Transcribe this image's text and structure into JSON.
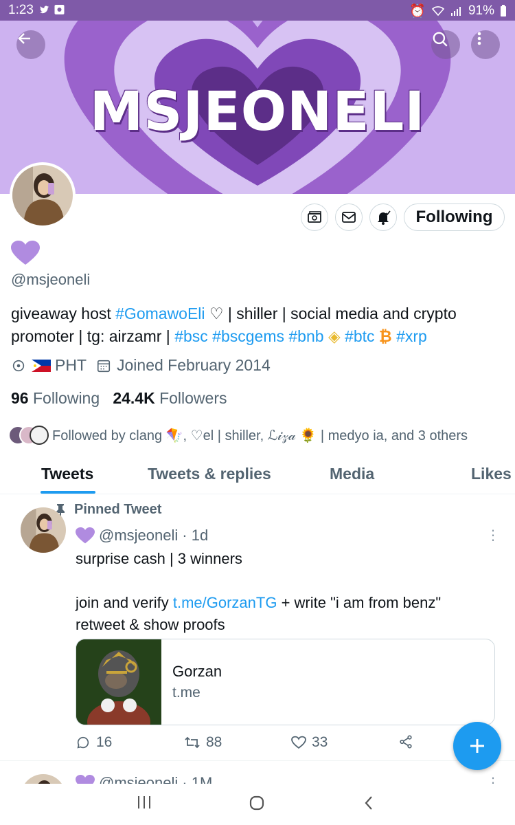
{
  "status_bar": {
    "time": "1:23",
    "battery": "91%"
  },
  "banner": {
    "title": "MSJEONELI",
    "colors": {
      "outer": "#cdb2f0",
      "ring": "#9a62cc",
      "inner": "#5c2e88"
    }
  },
  "profile": {
    "handle": "@msjeoneli",
    "bio_parts": {
      "p1": "giveaway host ",
      "t1": "#GomawoEli",
      "p2": " ♡ | shiller | social media and crypto promoter | tg: airzamr | ",
      "t2": "#bsc",
      "t3": "#bscgems",
      "t4": "#bnb",
      "t5": "#btc",
      "t6": "#xrp"
    },
    "location": "PHT",
    "joined": "Joined February 2014",
    "following_count": "96",
    "following_label": "Following",
    "followers_count": "24.4K",
    "followers_label": "Followers",
    "followed_by": "Followed by clang 🪁, ♡el | shiller, ℒ𝒾𝓏𝒶 🌻 | medyo ia, and 3 others",
    "follow_button": "Following"
  },
  "tabs": [
    "Tweets",
    "Tweets & replies",
    "Media",
    "Likes"
  ],
  "pinned_tweet": {
    "pinned_label": "Pinned Tweet",
    "handle": "@msjeoneli",
    "time": "· 1d",
    "text": "surprise cash | 3 winners\n\n",
    "text2": "join and verify ",
    "link": "t.me/GorzanTG",
    "text3": " + write \"i am from benz\"\nretweet & show proofs",
    "card_title": "Gorzan",
    "card_domain": "t.me",
    "replies": "16",
    "retweets": "88",
    "likes": "33"
  },
  "next_tweet": {
    "handle": "@msjeoneli",
    "time": "· 1M"
  },
  "colors": {
    "accent": "#1d9bf0",
    "purple": "#7f5aa8",
    "heart": "#b08be0"
  }
}
